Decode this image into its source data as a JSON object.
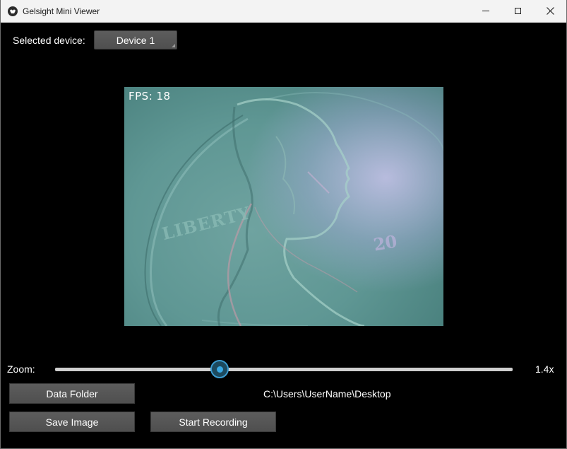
{
  "window": {
    "title": "Gelsight Mini Viewer",
    "controls": [
      "minimize",
      "maximize",
      "close"
    ]
  },
  "device": {
    "label": "Selected device:",
    "selected": "Device 1"
  },
  "camera": {
    "fps_text": "FPS: 18",
    "coin_text": "LIBERTY",
    "coin_year_fragment": "20"
  },
  "zoom": {
    "label": "Zoom:",
    "value_text": "1.4x",
    "level_fraction": 0.36
  },
  "actions": {
    "data_folder_label": "Data Folder",
    "data_folder_path": "C:\\Users\\UserName\\Desktop",
    "save_image_label": "Save Image",
    "start_recording_label": "Start Recording"
  },
  "colors": {
    "accent": "#39a8e4",
    "button_bg": "#565656",
    "background": "#000000"
  }
}
